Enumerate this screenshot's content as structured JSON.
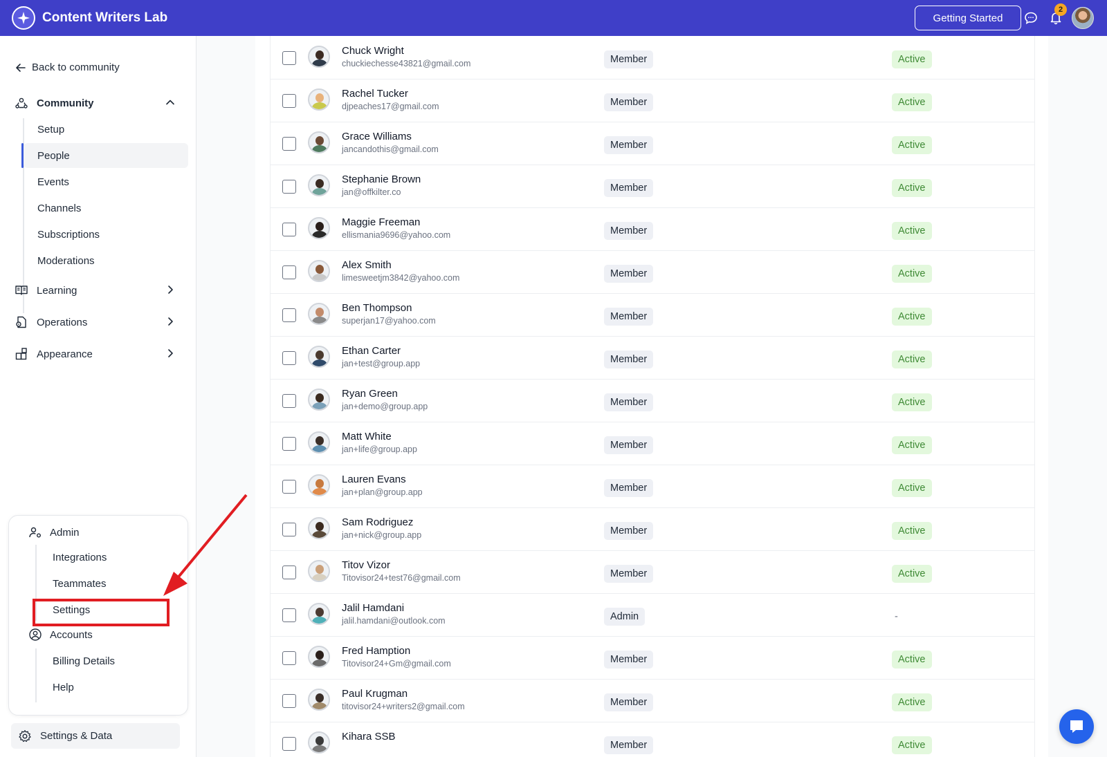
{
  "header": {
    "app_title": "Content Writers Lab",
    "getting_started_label": "Getting Started",
    "notification_count": "2",
    "brand_color": "#3f3fc8"
  },
  "sidebar": {
    "back_label": "Back to community",
    "community": {
      "label": "Community",
      "items": [
        {
          "label": "Setup"
        },
        {
          "label": "People"
        },
        {
          "label": "Events"
        },
        {
          "label": "Channels"
        },
        {
          "label": "Subscriptions"
        },
        {
          "label": "Moderations"
        }
      ]
    },
    "learning_label": "Learning",
    "operations_label": "Operations",
    "appearance_label": "Appearance",
    "admin_card": {
      "admin_label": "Admin",
      "admin_items": [
        {
          "label": "Integrations"
        },
        {
          "label": "Teammates"
        },
        {
          "label": "Settings"
        }
      ],
      "accounts_label": "Accounts",
      "accounts_items": [
        {
          "label": "Billing Details"
        },
        {
          "label": "Help"
        }
      ]
    },
    "settings_data_label": "Settings & Data"
  },
  "members": [
    {
      "name": "Chuck Wright",
      "email": "chuckiechesse43821@gmail.com",
      "role": "Member",
      "status": "Active"
    },
    {
      "name": "Rachel Tucker",
      "email": "djpeaches17@gmail.com",
      "role": "Member",
      "status": "Active"
    },
    {
      "name": "Grace Williams",
      "email": "jancandothis@gmail.com",
      "role": "Member",
      "status": "Active"
    },
    {
      "name": "Stephanie Brown",
      "email": "jan@offkilter.co",
      "role": "Member",
      "status": "Active"
    },
    {
      "name": "Maggie Freeman",
      "email": "ellismania9696@yahoo.com",
      "role": "Member",
      "status": "Active"
    },
    {
      "name": "Alex Smith",
      "email": "limesweetjm3842@yahoo.com",
      "role": "Member",
      "status": "Active"
    },
    {
      "name": "Ben Thompson",
      "email": "superjan17@yahoo.com",
      "role": "Member",
      "status": "Active"
    },
    {
      "name": "Ethan Carter",
      "email": "jan+test@group.app",
      "role": "Member",
      "status": "Active"
    },
    {
      "name": "Ryan Green",
      "email": "jan+demo@group.app",
      "role": "Member",
      "status": "Active"
    },
    {
      "name": "Matt White",
      "email": "jan+life@group.app",
      "role": "Member",
      "status": "Active"
    },
    {
      "name": "Lauren Evans",
      "email": "jan+plan@group.app",
      "role": "Member",
      "status": "Active"
    },
    {
      "name": "Sam Rodriguez",
      "email": "jan+nick@group.app",
      "role": "Member",
      "status": "Active"
    },
    {
      "name": "Titov Vizor",
      "email": "Titovisor24+test76@gmail.com",
      "role": "Member",
      "status": "Active"
    },
    {
      "name": "Jalil Hamdani",
      "email": "jalil.hamdani@outlook.com",
      "role": "Admin",
      "status": "-"
    },
    {
      "name": "Fred Hamption",
      "email": "Titovisor24+Gm@gmail.com",
      "role": "Member",
      "status": "Active"
    },
    {
      "name": "Paul Krugman",
      "email": "titovisor24+writers2@gmail.com",
      "role": "Member",
      "status": "Active"
    },
    {
      "name": "Kihara SSB",
      "email": "",
      "role": "Member",
      "status": "Active"
    }
  ],
  "colors": {
    "active_badge_bg": "#e3f8dd",
    "active_badge_text": "#3f8a35",
    "highlight_red": "#e11d22",
    "chat_button": "#2563eb"
  }
}
